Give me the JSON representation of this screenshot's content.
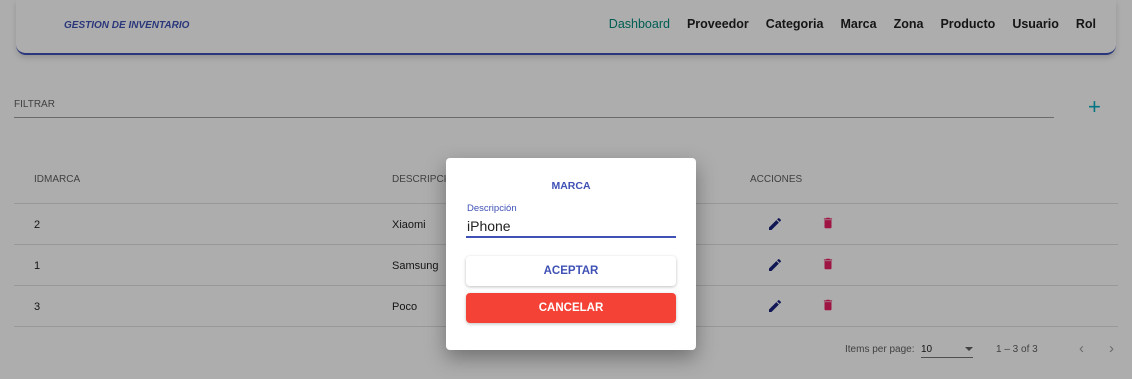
{
  "header": {
    "brand": "GESTION DE INVENTARIO",
    "nav": [
      "Dashboard",
      "Proveedor",
      "Categoria",
      "Marca",
      "Zona",
      "Producto",
      "Usuario",
      "Rol"
    ]
  },
  "filter": {
    "label": "FILTRAR",
    "value": ""
  },
  "table": {
    "columns": [
      "IDMARCA",
      "DESCRIPCION",
      "ACCIONES"
    ],
    "rows": [
      {
        "id": "2",
        "descripcion": "Xiaomi"
      },
      {
        "id": "1",
        "descripcion": "Samsung"
      },
      {
        "id": "3",
        "descripcion": "Poco"
      }
    ]
  },
  "paginator": {
    "items_per_page_label": "Items per page:",
    "items_per_page": "10",
    "range": "1 – 3 of 3"
  },
  "dialog": {
    "title": "MARCA",
    "field_label": "Descripción",
    "field_value": "iPhone",
    "accept": "ACEPTAR",
    "cancel": "CANCELAR"
  },
  "colors": {
    "primary": "#3f51b5",
    "accent": "#00acc1",
    "active_nav": "#00897b",
    "danger": "#f44336",
    "delete_icon": "#e91e63"
  }
}
